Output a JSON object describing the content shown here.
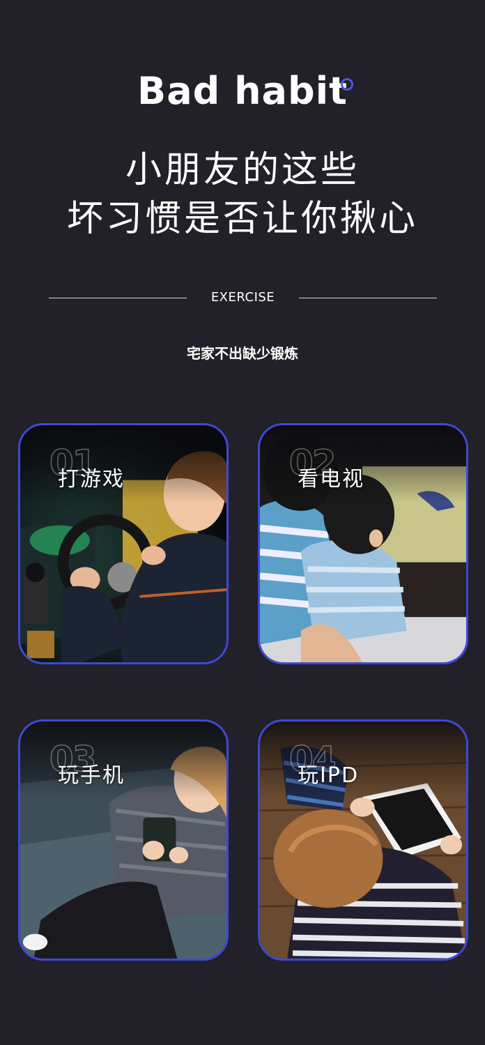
{
  "header": {
    "title_en": "Bad habit",
    "headline_line1": "小朋友的这些",
    "headline_line2": "坏习惯是否让你揪心"
  },
  "section": {
    "label": "EXERCISE",
    "subtitle": "宅家不出缺少锻炼"
  },
  "cards": [
    {
      "number": "01",
      "label": "打游戏",
      "image": "child-playing-arcade-driving-game"
    },
    {
      "number": "02",
      "label": "看电视",
      "image": "children-watching-tv"
    },
    {
      "number": "03",
      "label": "玩手机",
      "image": "child-using-phone-on-sofa"
    },
    {
      "number": "04",
      "label": "玩IPD",
      "image": "child-using-tablet-on-floor"
    }
  ],
  "colors": {
    "background": "#222028",
    "accent": "#3d49d6",
    "text": "#ffffff"
  }
}
